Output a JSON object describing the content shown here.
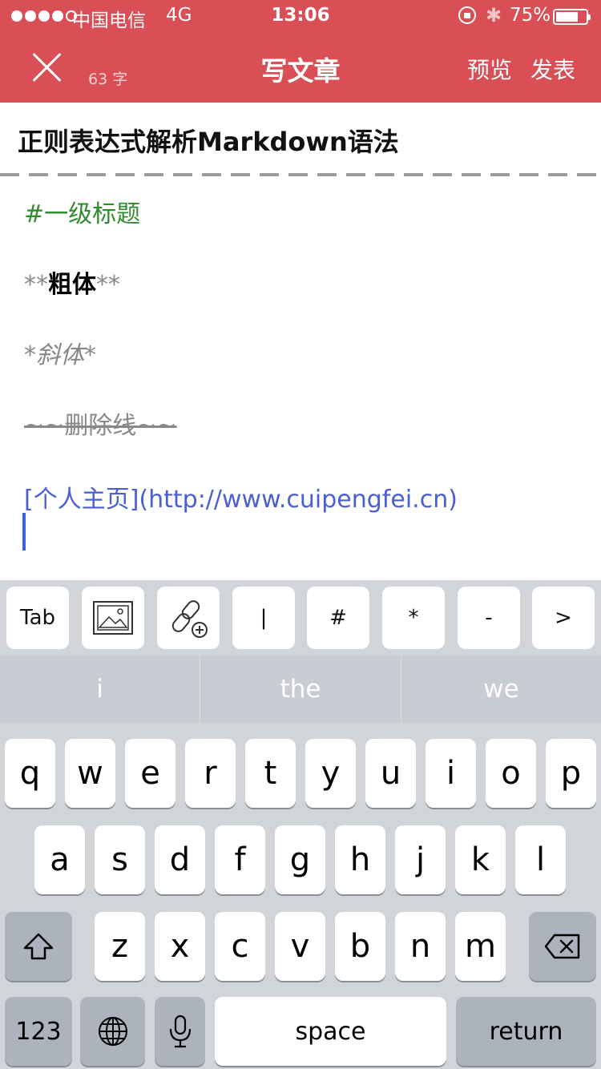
{
  "status_bar": {
    "carrier": "中国电信",
    "network": "4G",
    "time": "13:06",
    "battery_percent": "75%",
    "battery_level": 0.75,
    "icons": [
      "signal-dots-icon",
      "orientation-lock-icon",
      "bluetooth-icon",
      "battery-icon"
    ]
  },
  "nav": {
    "word_count": "63 字",
    "title": "写文章",
    "preview_label": "预览",
    "publish_label": "发表",
    "header_color": "#d94f55"
  },
  "article": {
    "title": "正则表达式解析Markdown语法",
    "lines": {
      "heading": "#一级标题",
      "bold_prefix": "**",
      "bold_text": "粗体",
      "bold_suffix": "**",
      "italic": "*斜体*",
      "strike": "~~删除线~~",
      "link": "[个人主页](http://www.cuipengfei.cn)"
    },
    "colors": {
      "heading": "#2e8b2e",
      "link": "#4a5fd6",
      "muted": "#888888"
    }
  },
  "toolbar": {
    "keys": [
      {
        "label": "Tab",
        "icon": ""
      },
      {
        "label": "",
        "icon": "image-icon"
      },
      {
        "label": "",
        "icon": "insert-link-icon"
      },
      {
        "label": "|"
      },
      {
        "label": "#"
      },
      {
        "label": "*"
      },
      {
        "label": "-"
      },
      {
        "label": ">"
      }
    ]
  },
  "suggestions": [
    "i",
    "the",
    "we"
  ],
  "keyboard": {
    "row1": [
      "q",
      "w",
      "e",
      "r",
      "t",
      "y",
      "u",
      "i",
      "o",
      "p"
    ],
    "row2": [
      "a",
      "s",
      "d",
      "f",
      "g",
      "h",
      "j",
      "k",
      "l"
    ],
    "row3": [
      "z",
      "x",
      "c",
      "v",
      "b",
      "n",
      "m"
    ],
    "numbers_label": "123",
    "space_label": "space",
    "return_label": "return",
    "icons": [
      "shift-icon",
      "backspace-icon",
      "globe-icon",
      "microphone-icon"
    ]
  }
}
